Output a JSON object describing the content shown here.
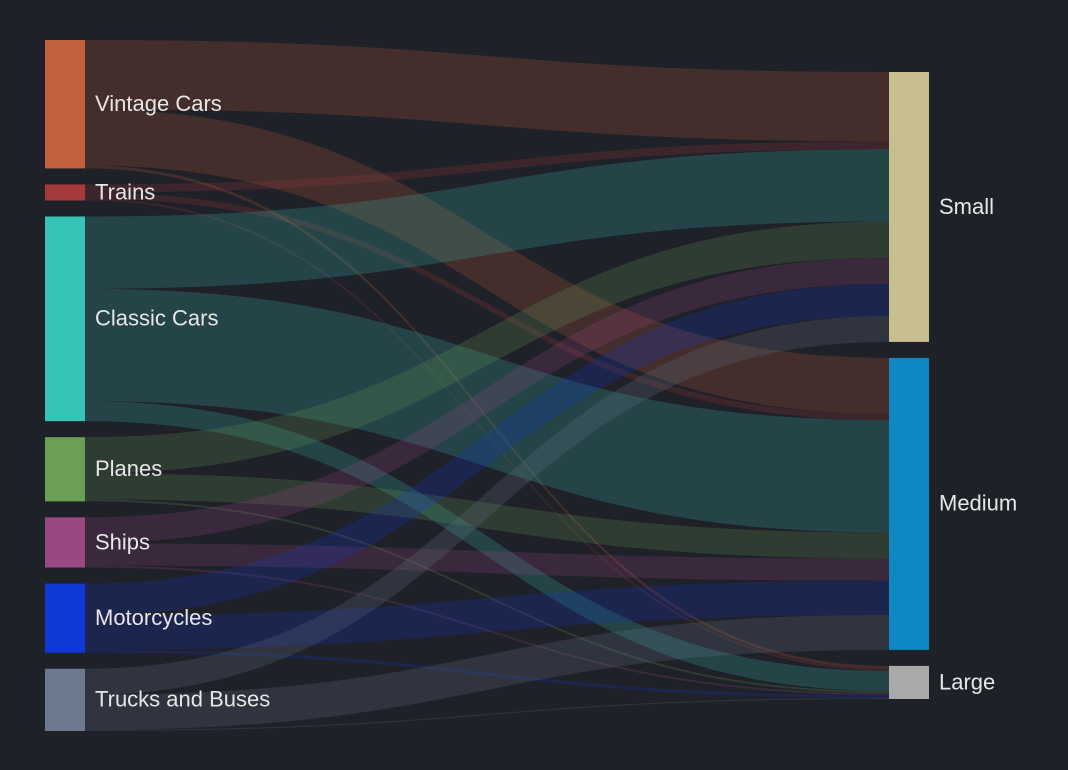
{
  "chart_data": {
    "type": "sankey",
    "sources": [
      {
        "name": "Vintage Cars",
        "color": "#c2613d"
      },
      {
        "name": "Trains",
        "color": "#a63a3a"
      },
      {
        "name": "Classic Cars",
        "color": "#36c3b8"
      },
      {
        "name": "Planes",
        "color": "#6a9f55"
      },
      {
        "name": "Ships",
        "color": "#9a4782"
      },
      {
        "name": "Motorcycles",
        "color": "#1038d6"
      },
      {
        "name": "Trucks and Buses",
        "color": "#6b7a8f"
      }
    ],
    "targets": [
      {
        "name": "Small",
        "color": "#c8bf8f"
      },
      {
        "name": "Medium",
        "color": "#0f87c2"
      },
      {
        "name": "Large",
        "color": "#a9a9a9"
      }
    ],
    "links": [
      {
        "source": "Vintage Cars",
        "target": "Small",
        "value": 69
      },
      {
        "source": "Vintage Cars",
        "target": "Medium",
        "value": 56
      },
      {
        "source": "Vintage Cars",
        "target": "Large",
        "value": 3
      },
      {
        "source": "Trains",
        "target": "Small",
        "value": 8
      },
      {
        "source": "Trains",
        "target": "Medium",
        "value": 6
      },
      {
        "source": "Trains",
        "target": "Large",
        "value": 2
      },
      {
        "source": "Classic Cars",
        "target": "Small",
        "value": 72
      },
      {
        "source": "Classic Cars",
        "target": "Medium",
        "value": 112
      },
      {
        "source": "Classic Cars",
        "target": "Large",
        "value": 20
      },
      {
        "source": "Planes",
        "target": "Small",
        "value": 36
      },
      {
        "source": "Planes",
        "target": "Medium",
        "value": 26
      },
      {
        "source": "Planes",
        "target": "Large",
        "value": 2
      },
      {
        "source": "Ships",
        "target": "Small",
        "value": 26
      },
      {
        "source": "Ships",
        "target": "Medium",
        "value": 22
      },
      {
        "source": "Ships",
        "target": "Large",
        "value": 2
      },
      {
        "source": "Motorcycles",
        "target": "Small",
        "value": 32
      },
      {
        "source": "Motorcycles",
        "target": "Medium",
        "value": 34
      },
      {
        "source": "Motorcycles",
        "target": "Large",
        "value": 3
      },
      {
        "source": "Trucks and Buses",
        "target": "Small",
        "value": 26
      },
      {
        "source": "Trucks and Buses",
        "target": "Medium",
        "value": 35
      },
      {
        "source": "Trucks and Buses",
        "target": "Large",
        "value": 1
      }
    ]
  }
}
